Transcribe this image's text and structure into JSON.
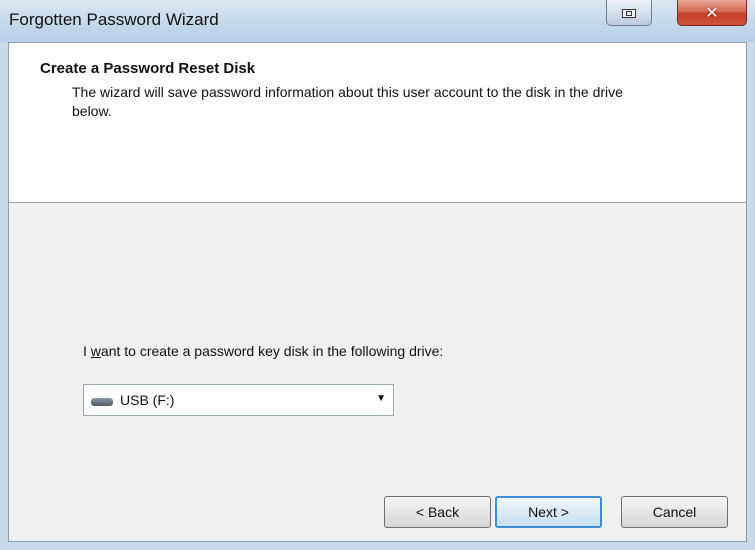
{
  "window": {
    "title": "Forgotten Password Wizard",
    "restore_icon": "restore-icon",
    "close_label": "✕"
  },
  "header": {
    "title": "Create a Password Reset Disk",
    "description": "The wizard will save password information about this user account to the disk in the drive below."
  },
  "drive": {
    "prompt_before": "I ",
    "prompt_accel": "w",
    "prompt_after": "ant to create a password key disk in the following drive:",
    "selected": "USB (F:)",
    "icon": "usb-drive-icon"
  },
  "buttons": {
    "back": "< Back",
    "next": "Next >",
    "cancel": "Cancel"
  },
  "colors": {
    "focus_border": "#3c8fd6",
    "close_button": "#c2402a"
  }
}
